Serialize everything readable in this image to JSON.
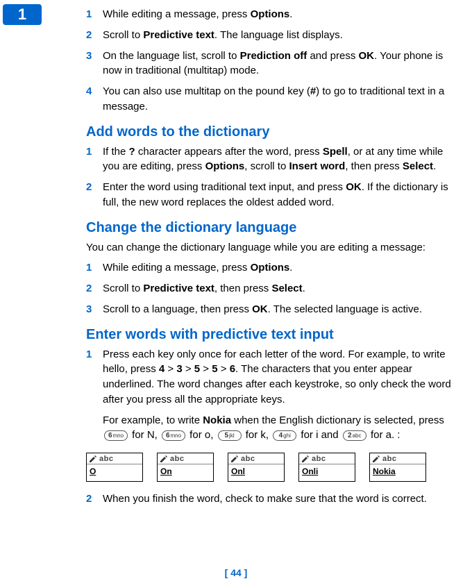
{
  "tab_number": "1",
  "steps_a": [
    {
      "n": "1",
      "parts": [
        "While editing a message, press ",
        {
          "b": "Options"
        },
        "."
      ]
    },
    {
      "n": "2",
      "parts": [
        "Scroll to ",
        {
          "b": "Predictive text"
        },
        ". The language list displays."
      ]
    },
    {
      "n": "3",
      "parts": [
        "On the language list, scroll to ",
        {
          "b": "Prediction off"
        },
        " and press ",
        {
          "b": "OK"
        },
        ". Your phone is now in traditional (multitap) mode."
      ]
    },
    {
      "n": "4",
      "parts": [
        "You can also use multitap on the pound key (",
        {
          "b": "#"
        },
        ") to go to traditional text in a message."
      ]
    }
  ],
  "section_b_title": "Add words to the dictionary",
  "steps_b": [
    {
      "n": "1",
      "parts": [
        "If the ",
        {
          "b": "?"
        },
        " character appears after the word, press ",
        {
          "b": "Spell"
        },
        ", or at any time while you are editing, press ",
        {
          "b": "Options"
        },
        ", scroll to ",
        {
          "b": "Insert word"
        },
        ", then press ",
        {
          "b": "Select"
        },
        "."
      ]
    },
    {
      "n": "2",
      "parts": [
        "Enter the word using traditional text input, and press ",
        {
          "b": "OK"
        },
        ". If the dictionary is full, the new word replaces the oldest added word."
      ]
    }
  ],
  "section_c_title": "Change the dictionary language",
  "section_c_intro": "You can change the dictionary language while you are editing a message:",
  "steps_c": [
    {
      "n": "1",
      "parts": [
        "While editing a message, press ",
        {
          "b": "Options"
        },
        "."
      ]
    },
    {
      "n": "2",
      "parts": [
        "Scroll to ",
        {
          "b": "Predictive text"
        },
        ", then press ",
        {
          "b": "Select"
        },
        "."
      ]
    },
    {
      "n": "3",
      "parts": [
        "Scroll to a language, then press ",
        {
          "b": "OK"
        },
        ". The selected language is  active."
      ]
    }
  ],
  "section_d_title": "Enter words with predictive text input",
  "steps_d1": {
    "n": "1",
    "parts": [
      "Press each key only once for each letter of the word. For example, to write hello, press ",
      {
        "b": "4"
      },
      " > ",
      {
        "b": "3"
      },
      " > ",
      {
        "b": "5"
      },
      " > ",
      {
        "b": "5"
      },
      " > ",
      {
        "b": "6"
      },
      ". The characters that you enter appear underlined. The word changes after each keystroke, so only check the word after you press all the appropriate keys."
    ]
  },
  "example_line": {
    "prefix": "For example, to write ",
    "word_bold": "Nokia",
    "mid": " when the English dictionary is selected, press ",
    "keys": [
      {
        "num": "6",
        "letters": "mno",
        "after": " for N, "
      },
      {
        "num": "6",
        "letters": "mno",
        "after": " for o, "
      },
      {
        "num": "5",
        "letters": "jkl",
        "after": " for k, "
      },
      {
        "num": "4",
        "letters": "ghi",
        "after": " for i and "
      },
      {
        "num": "2",
        "letters": "abc",
        "after": " for a. :"
      }
    ]
  },
  "screens_abc_label": "abc",
  "screen_words": [
    "O",
    "On",
    "Onl",
    "Onli",
    "Nokia"
  ],
  "steps_d2": {
    "n": "2",
    "parts": [
      "When you finish the word, check to make sure that the word is correct."
    ]
  },
  "page_number": "[ 44 ]"
}
